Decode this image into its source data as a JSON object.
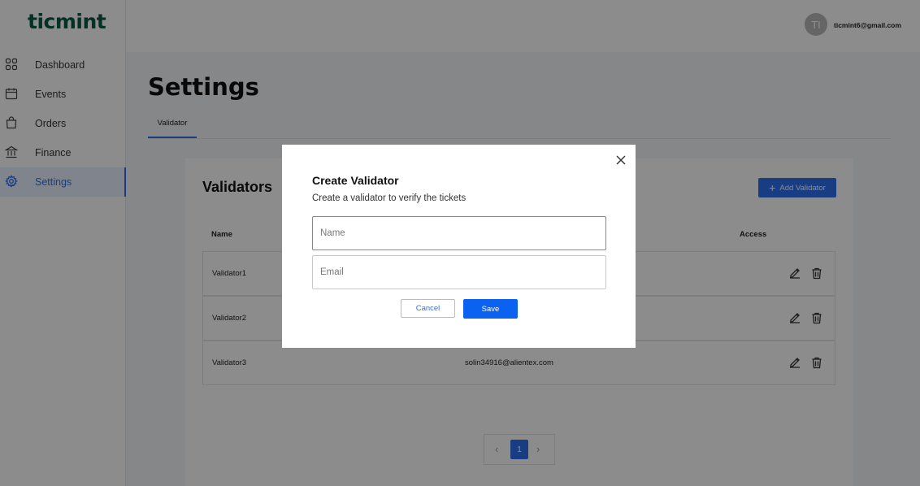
{
  "brand": {
    "logo": "ticmint",
    "color": "#0a5a44"
  },
  "sidebar": {
    "items": [
      {
        "label": "Dashboard",
        "icon": "grid-icon"
      },
      {
        "label": "Events",
        "icon": "calendar-icon"
      },
      {
        "label": "Orders",
        "icon": "bag-icon"
      },
      {
        "label": "Finance",
        "icon": "bank-icon"
      },
      {
        "label": "Settings",
        "icon": "gear-icon",
        "active": true
      }
    ]
  },
  "header": {
    "avatar_initials": "TI",
    "user_email": "ticmint6@gmail.com"
  },
  "page": {
    "title": "Settings",
    "tabs": [
      {
        "label": "Validator",
        "active": true
      }
    ]
  },
  "validators": {
    "title": "Validators",
    "add_button": "Add Validator",
    "columns": {
      "name": "Name",
      "access": "Access"
    },
    "rows": [
      {
        "name": "Validator1",
        "email": ""
      },
      {
        "name": "Validator2",
        "email": ""
      },
      {
        "name": "Validator3",
        "email": "solin34916@alientex.com"
      }
    ]
  },
  "pagination": {
    "current_page": "1",
    "prev": "‹",
    "next": "›"
  },
  "modal": {
    "title": "Create Validator",
    "subtitle": "Create a validator to verify the tickets",
    "name_placeholder": "Name",
    "email_placeholder": "Email",
    "cancel_label": "Cancel",
    "save_label": "Save"
  },
  "colors": {
    "accent": "#2f6fed",
    "save": "#0b62f0",
    "active_nav": "#2f6fed"
  }
}
